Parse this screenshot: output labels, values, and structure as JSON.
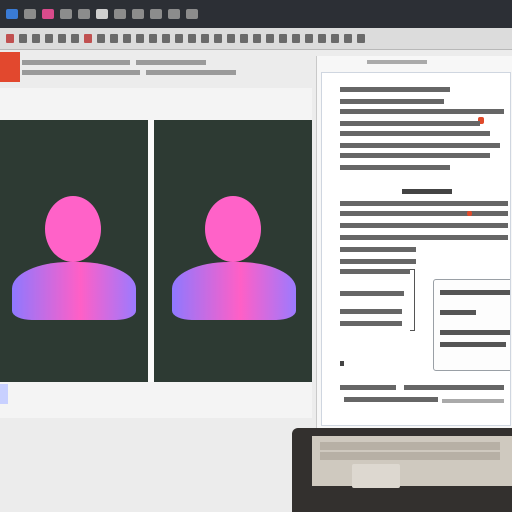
{
  "title_bar": {
    "icons": [
      {
        "name": "app-icon",
        "color": "#3a7bd5"
      },
      {
        "name": "file-icon",
        "color": "#8c8c8c"
      },
      {
        "name": "image-icon",
        "color": "#d94b8c"
      },
      {
        "name": "layers-icon",
        "color": "#8c8c8c"
      },
      {
        "name": "grid-icon",
        "color": "#8c8c8c"
      },
      {
        "name": "select-icon",
        "color": "#cfcfcf"
      },
      {
        "name": "crop-icon",
        "color": "#8c8c8c"
      },
      {
        "name": "brush-icon",
        "color": "#8c8c8c"
      },
      {
        "name": "eraser-icon",
        "color": "#8c8c8c"
      },
      {
        "name": "text-icon",
        "color": "#8c8c8c"
      },
      {
        "name": "zoom-icon",
        "color": "#8c8c8c"
      }
    ]
  },
  "colors": {
    "accent": "#e2482e",
    "panel_bg": "#2d3a33",
    "avatar_head": "#ff62c8",
    "avatar_body_start": "#8f78ff",
    "avatar_body_end": "#ff5fc6"
  },
  "canvas": {
    "panels": [
      {
        "name": "left-preview-panel",
        "avatar": "user-avatar-icon"
      },
      {
        "name": "right-preview-panel",
        "avatar": "user-avatar-icon"
      }
    ]
  }
}
